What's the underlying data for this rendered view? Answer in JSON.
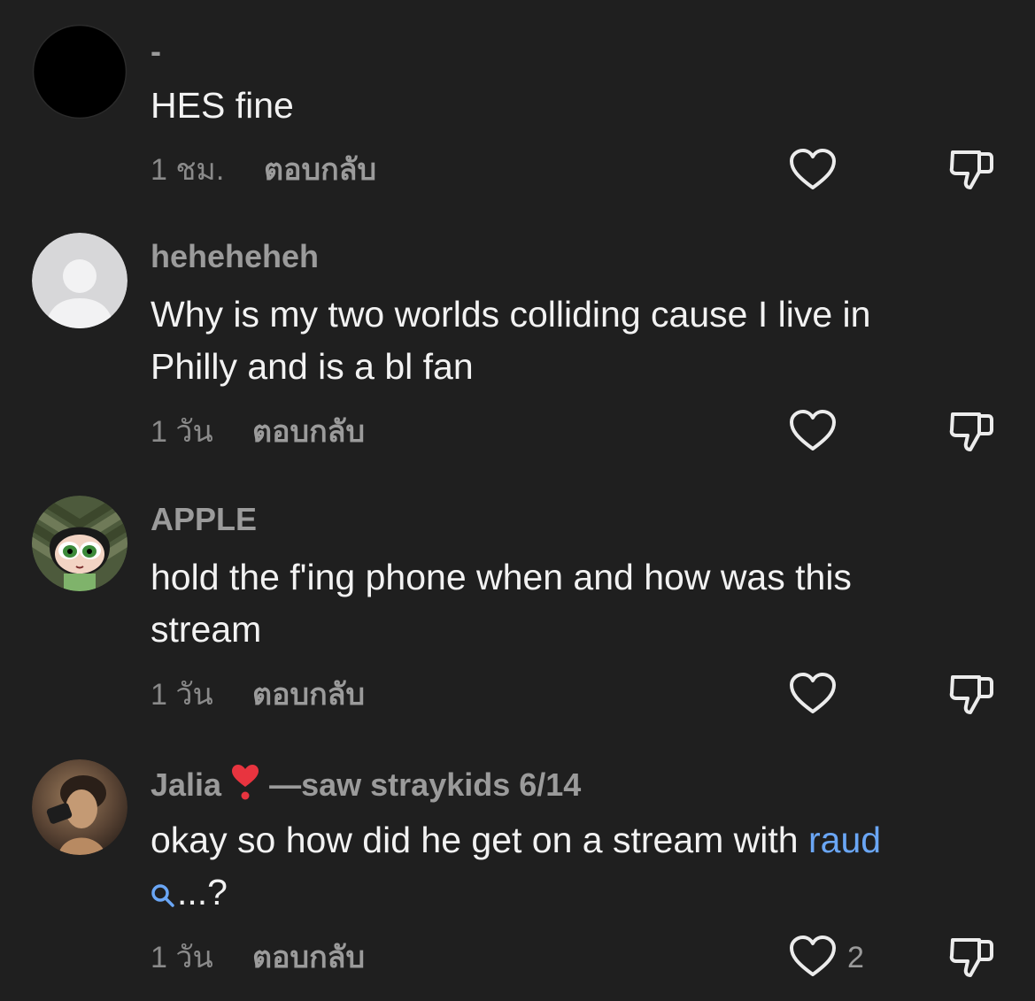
{
  "comments": [
    {
      "username": "-",
      "text": "HES fine",
      "time": "1 ชม.",
      "reply_label": "ตอบกลับ",
      "likes": ""
    },
    {
      "username": "heheheheh",
      "text_line1": "Why is my two worlds colliding cause I live in",
      "text_line2": "Philly and is a bl fan",
      "time": "1 วัน",
      "reply_label": "ตอบกลับ",
      "likes": ""
    },
    {
      "username": "APPLE",
      "text_line1": "hold the f'ing phone when and how was this",
      "text_line2": "stream",
      "time": "1 วัน",
      "reply_label": "ตอบกลับ",
      "likes": ""
    },
    {
      "username_prefix": "Jalia",
      "username_suffix": "—saw straykids 6/14",
      "text_line1": "okay so how did he get on a stream with",
      "mention": "raud",
      "text_line2": "...?",
      "time": "1 วัน",
      "reply_label": "ตอบกลับ",
      "likes": "2"
    }
  ],
  "colors": {
    "background": "#1f1f1f",
    "text": "#f2f2f2",
    "secondary": "#9b9b9b",
    "mention": "#6aa6f5",
    "heart_badge": "#e8343f"
  },
  "icons": {
    "like": "heart-icon",
    "dislike": "thumbs-down-icon",
    "search": "search-icon",
    "username_badge": "red-heart-exclamation-icon"
  }
}
